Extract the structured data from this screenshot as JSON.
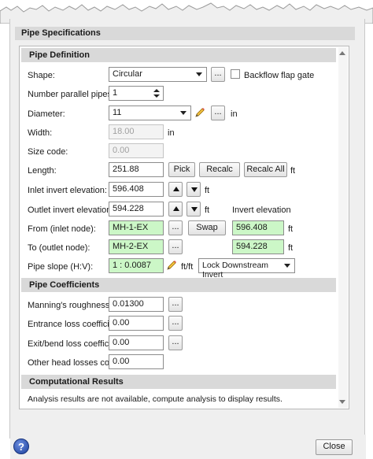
{
  "dialog": {
    "title": "Pipe Specifications",
    "close_label": "Close",
    "help_label": "?"
  },
  "pipe_definition": {
    "header": "Pipe Definition",
    "shape_label": "Shape:",
    "shape_value": "Circular",
    "backflow_label": "Backflow flap gate",
    "backflow_checked": false,
    "parallel_label": "Number parallel pipes:",
    "parallel_value": "1",
    "diameter_label": "Diameter:",
    "diameter_value": "11",
    "diameter_unit": "in",
    "width_label": "Width:",
    "width_value": "18.00",
    "width_unit": "in",
    "size_code_label": "Size code:",
    "size_code_value": "0.00",
    "length_label": "Length:",
    "length_value": "251.88",
    "pick_label": "Pick",
    "recalc_label": "Recalc",
    "recalc_all_label": "Recalc All",
    "length_unit": "ft",
    "inlet_label": "Inlet invert elevation:",
    "inlet_value": "596.408",
    "inlet_unit": "ft",
    "outlet_label": "Outlet invert elevation:",
    "outlet_value": "594.228",
    "outlet_unit": "ft",
    "invert_elevation_label": "Invert elevation",
    "from_label": "From (inlet node):",
    "from_value": "MH-1-EX",
    "swap_label": "Swap",
    "from_elev_value": "596.408",
    "from_elev_unit": "ft",
    "to_label": "To (outlet node):",
    "to_value": "MH-2-EX",
    "to_elev_value": "594.228",
    "to_elev_unit": "ft",
    "slope_label": "Pipe slope (H:V):",
    "slope_value": "1 : 0.0087",
    "slope_unit": "ft/ft",
    "lock_value": "Lock Downstream Invert",
    "dots_label": "..."
  },
  "pipe_coefficients": {
    "header": "Pipe Coefficients",
    "manning_label": "Manning's roughness:",
    "manning_value": "0.01300",
    "entrance_label": "Entrance loss coefficient:",
    "entrance_value": "0.00",
    "exit_label": "Exit/bend loss coefficient:",
    "exit_value": "0.00",
    "other_label": "Other head losses coeff:",
    "other_value": "0.00"
  },
  "computational_results": {
    "header": "Computational Results",
    "message": "Analysis results are not available, compute analysis to display results."
  },
  "colors": {
    "computed_field": "#ccf7c7",
    "section_header": "#d9d9d9",
    "dialog_bg": "#efefef"
  }
}
